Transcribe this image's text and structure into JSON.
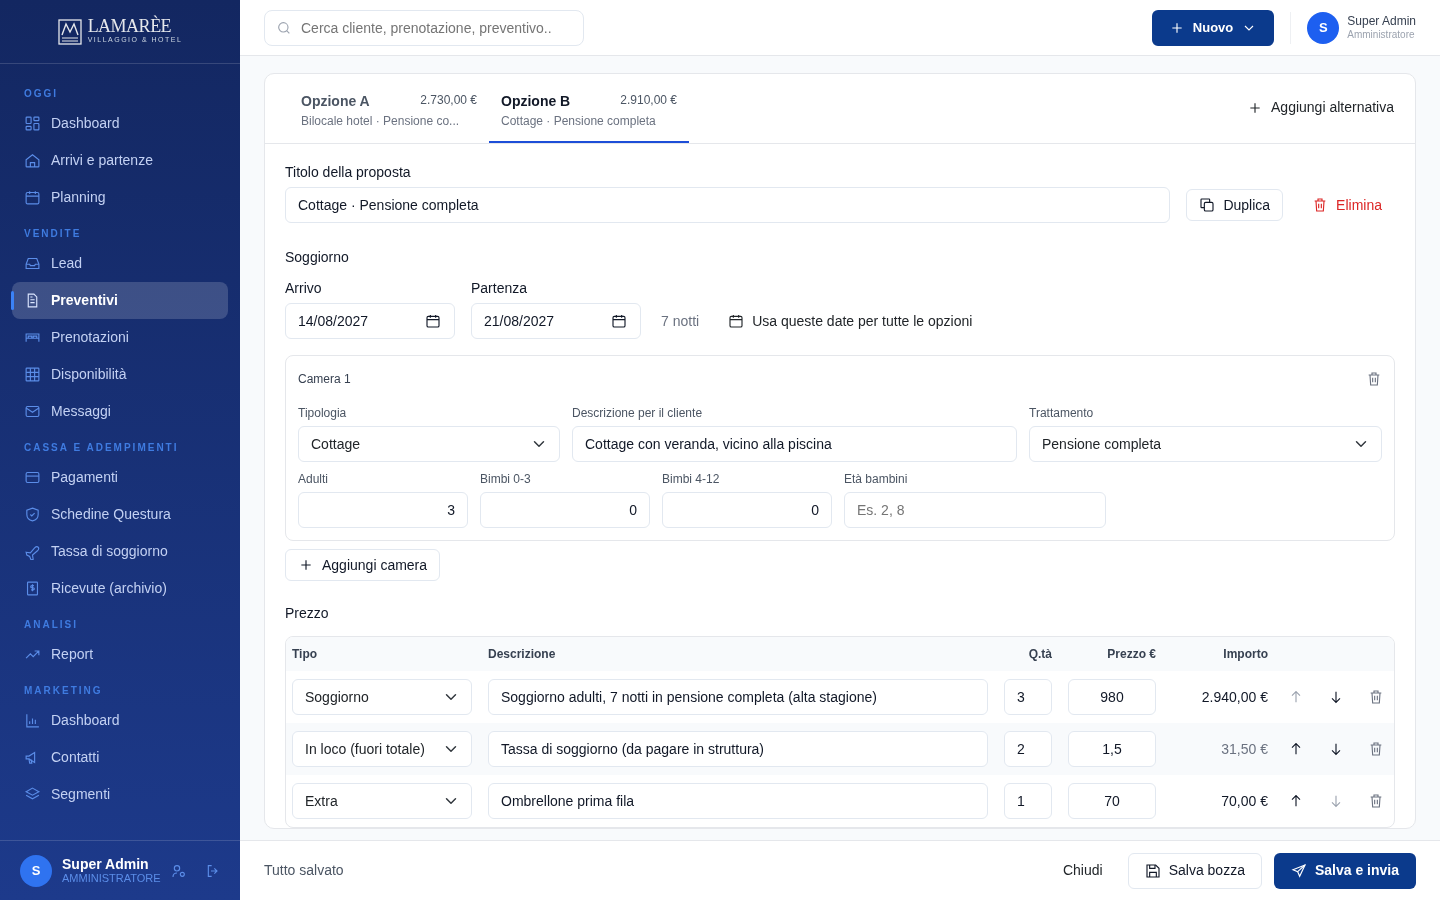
{
  "sidebar": {
    "logo": {
      "name": "LAMARÈE",
      "tagline": "VILLAGGIO & HOTEL"
    },
    "sections": [
      {
        "title": "OGGI",
        "items": [
          {
            "label": "Dashboard",
            "selected": false
          },
          {
            "label": "Arrivi e partenze",
            "selected": false
          },
          {
            "label": "Planning",
            "selected": false
          }
        ]
      },
      {
        "title": "VENDITE",
        "items": [
          {
            "label": "Lead",
            "selected": false
          },
          {
            "label": "Preventivi",
            "selected": true
          },
          {
            "label": "Prenotazioni",
            "selected": false
          },
          {
            "label": "Disponibilità",
            "selected": false
          },
          {
            "label": "Messaggi",
            "selected": false
          }
        ]
      },
      {
        "title": "CASSA E ADEMPIMENTI",
        "items": [
          {
            "label": "Pagamenti",
            "selected": false
          },
          {
            "label": "Schedine Questura",
            "selected": false
          },
          {
            "label": "Tassa di soggiorno",
            "selected": false
          },
          {
            "label": "Ricevute (archivio)",
            "selected": false
          }
        ]
      },
      {
        "title": "ANALISI",
        "items": [
          {
            "label": "Report",
            "selected": false
          }
        ]
      },
      {
        "title": "MARKETING",
        "items": [
          {
            "label": "Dashboard",
            "selected": false
          },
          {
            "label": "Contatti",
            "selected": false
          },
          {
            "label": "Segmenti",
            "selected": false
          }
        ]
      }
    ],
    "user": {
      "avatar": "S",
      "name": "Super Admin",
      "role": "AMMINISTRATORE"
    }
  },
  "topbar": {
    "search": {
      "placeholder": "Cerca cliente, prenotazione, preventivo.."
    },
    "new_button": "Nuovo",
    "user": {
      "avatar": "S",
      "name": "Super Admin",
      "role": "Amministratore"
    }
  },
  "options": {
    "tabs": [
      {
        "name": "Opzione A",
        "price": "2.730,00 €",
        "subtitle": "Bilocale hotel · Pensione co...",
        "selected": false
      },
      {
        "name": "Opzione B",
        "price": "2.910,00 €",
        "subtitle": "Cottage · Pensione completa",
        "selected": true
      }
    ],
    "add_button": "Aggiungi alternativa"
  },
  "proposal": {
    "label": "Titolo della proposta",
    "value": "Cottage · Pensione completa",
    "duplicate": "Duplica",
    "delete": "Elimina"
  },
  "stay": {
    "heading": "Soggiorno",
    "arrival_label": "Arrivo",
    "arrival": "14/08/2027",
    "departure_label": "Partenza",
    "departure": "21/08/2027",
    "nights": "7 notti",
    "apply_all": "Usa queste date per tutte le opzioni"
  },
  "rooms": [
    {
      "title": "Camera 1",
      "type_label": "Tipologia",
      "type": "Cottage",
      "description_label": "Descrizione per il cliente",
      "description": "Cottage con veranda, vicino alla piscina",
      "board_label": "Trattamento",
      "board": "Pensione completa",
      "guests": [
        {
          "label": "Adulti",
          "value": "3"
        },
        {
          "label": "Bimbi 0-3",
          "value": "0"
        },
        {
          "label": "Bimbi 4-12",
          "value": "0"
        }
      ],
      "ages": {
        "label": "Età bambini",
        "placeholder": "Es. 2, 8"
      }
    }
  ],
  "add_room": "Aggiungi camera",
  "price": {
    "heading": "Prezzo",
    "columns": [
      "Tipo",
      "Descrizione",
      "Q.tà",
      "Prezzo €",
      "Importo"
    ],
    "rows": [
      {
        "type": "Soggiorno",
        "description": "Soggiorno adulti, 7 notti in pensione completa (alta stagione)",
        "qty": "3",
        "price": "980",
        "amount": "2.940,00 €",
        "excluded": false,
        "up_disabled": true,
        "down_disabled": false
      },
      {
        "type": "In loco (fuori totale)",
        "description": "Tassa di soggiorno (da pagare in struttura)",
        "qty": "2",
        "price": "1,5",
        "amount": "31,50 €",
        "excluded": true,
        "up_disabled": false,
        "down_disabled": false
      },
      {
        "type": "Extra",
        "description": "Ombrellone prima fila",
        "qty": "1",
        "price": "70",
        "amount": "70,00 €",
        "excluded": false,
        "up_disabled": false,
        "down_disabled": true
      }
    ]
  },
  "footer": {
    "status": "Tutto salvato",
    "close": "Chiudi",
    "save_draft": "Salva bozza",
    "save_send": "Salva e invia"
  }
}
